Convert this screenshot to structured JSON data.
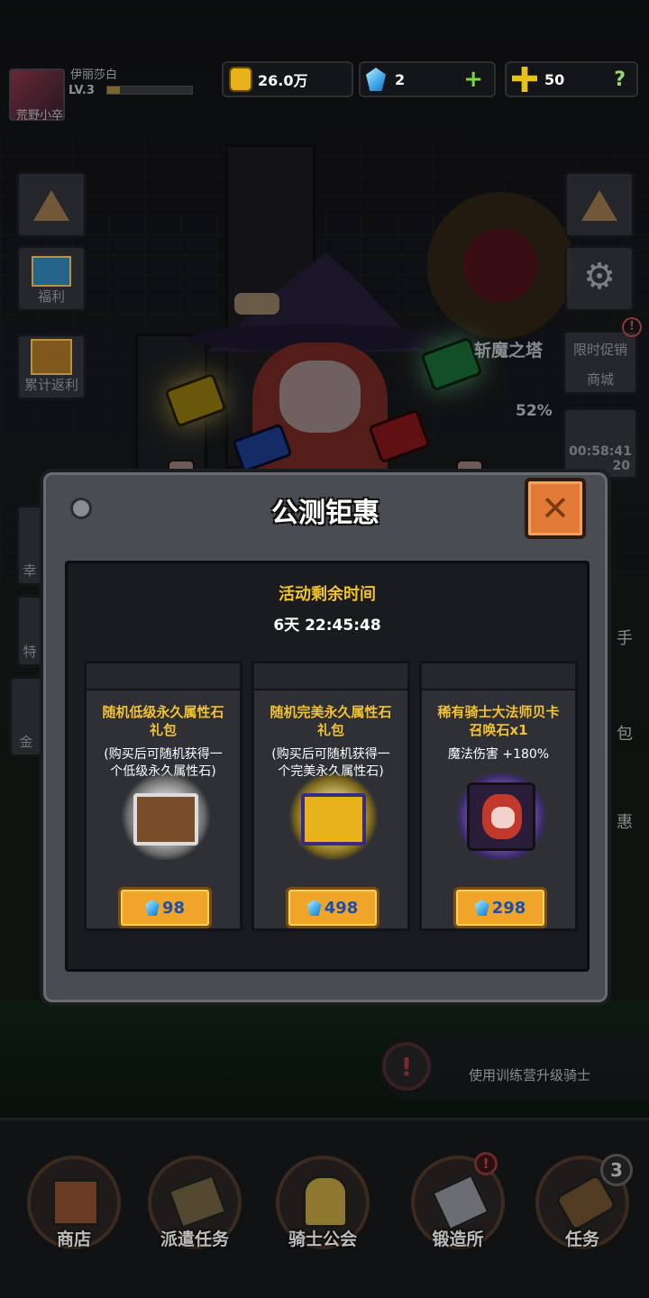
{
  "player": {
    "name": "伊丽莎白",
    "level": "LV.3",
    "caption": "荒野小卒",
    "xp_fraction": 0.15
  },
  "resources": {
    "gold": "26.0万",
    "gems": "2",
    "crosses": "50",
    "add_symbol": "+",
    "help_symbol": "?"
  },
  "left_menu": [
    {
      "label": "",
      "icon": "home-arrow-icon"
    },
    {
      "label": "福利",
      "icon": "welfare-basket-icon"
    },
    {
      "label": "累计返利",
      "icon": "chest-icon"
    },
    {
      "label": "幸",
      "icon": "luck-icon"
    },
    {
      "label": "特",
      "icon": "special-icon"
    },
    {
      "label": "金",
      "icon": "gold-icon"
    }
  ],
  "right_menu": {
    "tower_label": "斩魔之塔",
    "tower_progress": "52%",
    "promo_label": "限时促销",
    "shop_label": "商城",
    "timer": "00:58:41",
    "timer_sub": "20",
    "side_chars": [
      "手",
      "包",
      "惠"
    ]
  },
  "modal": {
    "title": "公测钜惠",
    "close_symbol": "✕",
    "countdown_label": "活动剩余时间",
    "countdown_value": "6天 22:45:48",
    "cards": [
      {
        "title_line1": "随机低级永久属性石",
        "title_line2": "礼包",
        "desc_line1": "(购买后可随机获得一",
        "desc_line2": "个低级永久属性石)",
        "price": "98",
        "art": "silver-chest-icon"
      },
      {
        "title_line1": "随机完美永久属性石",
        "title_line2": "礼包",
        "desc_line1": "(购买后可随机获得一",
        "desc_line2": "个完美永久属性石)",
        "price": "498",
        "art": "gold-chest-icon"
      },
      {
        "title_line1": "稀有骑士大法师贝卡",
        "title_line2": "召唤石x1",
        "desc_line1": "魔法伤害 +180%",
        "desc_line2": "",
        "price": "298",
        "art": "mage-portrait-icon"
      }
    ]
  },
  "hint": {
    "text": "使用训练营升级骑士",
    "symbol": "!"
  },
  "nav": [
    {
      "label": "商店",
      "icon": "shop-icon"
    },
    {
      "label": "派遣任务",
      "icon": "dispatch-icon"
    },
    {
      "label": "骑士公会",
      "icon": "knight-helmet-icon"
    },
    {
      "label": "锻造所",
      "icon": "anvil-icon"
    },
    {
      "label": "任务",
      "icon": "quest-scroll-icon",
      "badge": "3"
    }
  ],
  "colors": {
    "accent_gold": "#f2c230",
    "price_bg": "#f0a42a",
    "gem_blue": "#3fa7e8",
    "close_orange": "#e07a36"
  }
}
